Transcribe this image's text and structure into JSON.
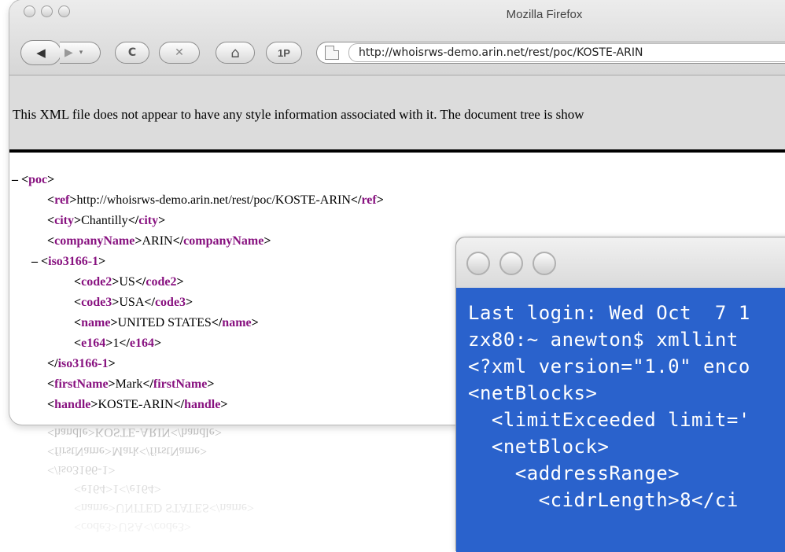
{
  "browser": {
    "title": "Mozilla Firefox",
    "url": "http://whoisrws-demo.arin.net/rest/poc/KOSTE-ARIN",
    "nav": {
      "back_icon": "◀",
      "forward_icon": "▶",
      "dropdown_icon": "▾",
      "reload_icon": "C",
      "stop_icon": "✕",
      "home_icon": "⌂",
      "onepassword_label": "1P"
    },
    "info_message": "This XML file does not appear to have any style information associated with it. The document tree is show"
  },
  "xml": {
    "poc_collapse": "–",
    "poc": "poc",
    "ref_value": "http://whoisrws-demo.arin.net/rest/poc/KOSTE-ARIN",
    "ref": "ref",
    "city": "city",
    "city_value": "Chantilly",
    "companyName": "companyName",
    "companyName_value": "ARIN",
    "iso_collapse": "–",
    "iso": "iso3166-1",
    "code2": "code2",
    "code2_value": "US",
    "code3": "code3",
    "code3_value": "USA",
    "name": "name",
    "name_value": "UNITED STATES",
    "e164": "e164",
    "e164_value": "1",
    "firstName": "firstName",
    "firstName_value": "Mark",
    "handle": "handle",
    "handle_value": "KOSTE-ARIN"
  },
  "terminal": {
    "lines": [
      "Last login: Wed Oct  7 1",
      "zx80:~ anewton$ xmllint",
      "<?xml version=\"1.0\" enco",
      "<netBlocks>",
      "  <limitExceeded limit='",
      "  <netBlock>",
      "    <addressRange>",
      "      <cidrLength>8</ci"
    ]
  },
  "colors": {
    "xml_tag": "#881280",
    "terminal_bg": "#2a62cc"
  }
}
